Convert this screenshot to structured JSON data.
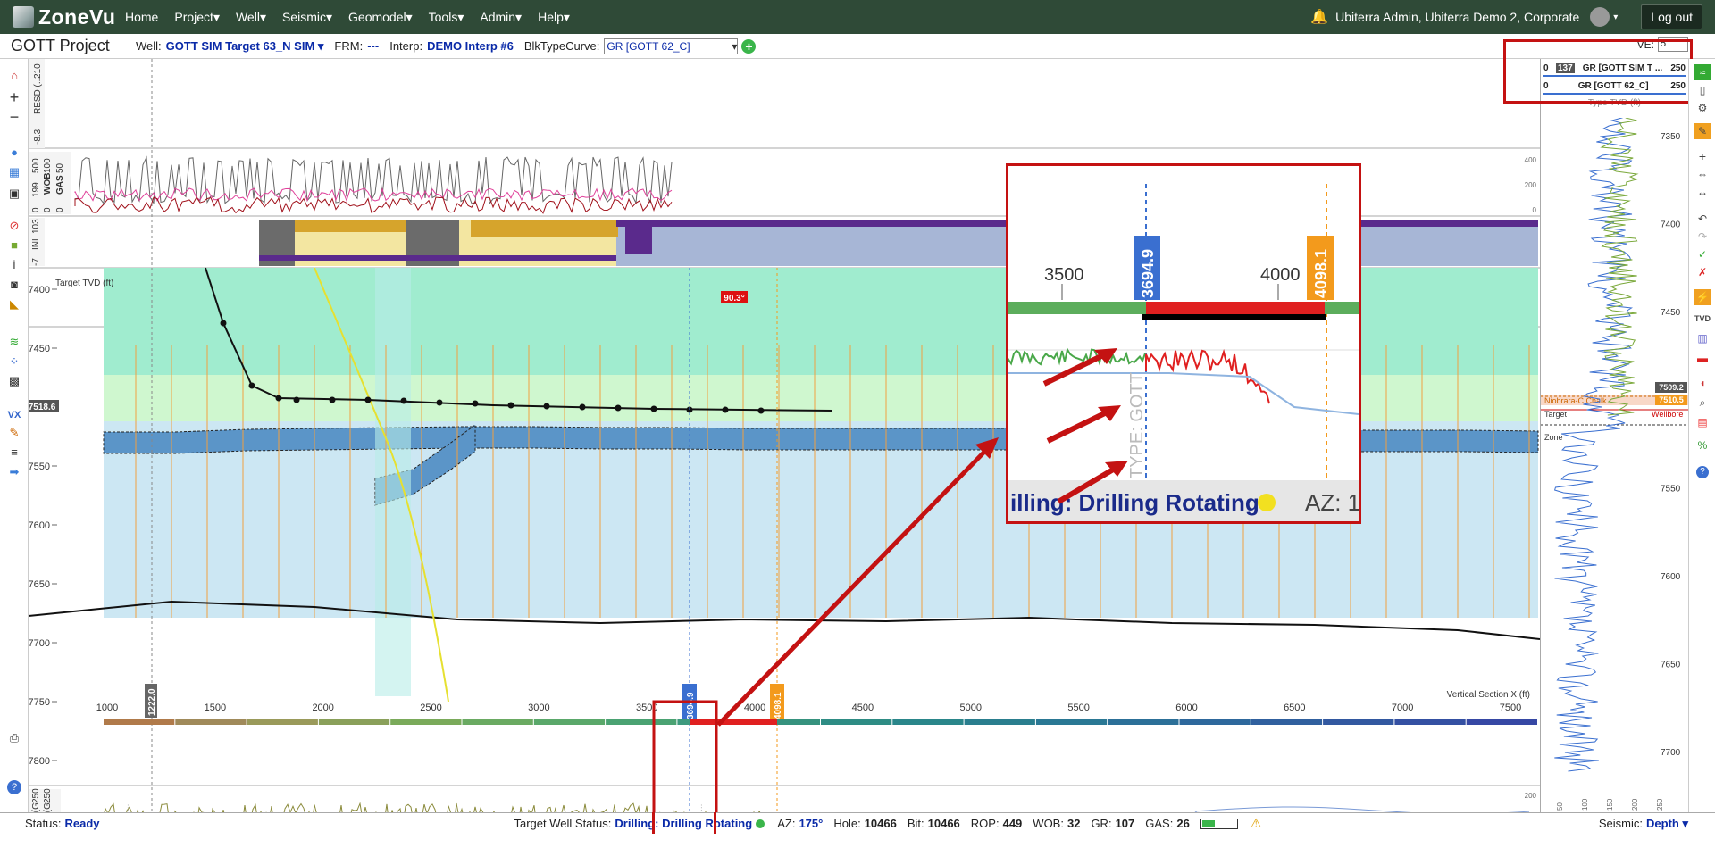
{
  "app": {
    "logo_text": "ZoneVu"
  },
  "nav": [
    "Home",
    "Project",
    "Well",
    "Seismic",
    "Geomodel",
    "Tools",
    "Admin",
    "Help"
  ],
  "user": {
    "name": "Ubiterra Admin, Ubiterra Demo 2, Corporate",
    "logout": "Log out"
  },
  "toolbar": {
    "project": "GOTT Project",
    "well_label": "Well:",
    "well_value": "GOTT SIM Target 63_N SIM",
    "frm_label": "FRM:",
    "frm_value": "---",
    "interp_label": "Interp:",
    "interp_value": "DEMO Interp #6",
    "curve_label": "BlkTypeCurve:",
    "curve_value": "GR [GOTT 62_C]",
    "ve_label": "VE:",
    "ve_value": "5"
  },
  "tracks": {
    "resd_label": "RESD (...",
    "resd_min": "-8.3",
    "resd_max": "210",
    "wob_label": "WOB",
    "wob_min": "0",
    "wob_max": "100",
    "gas_label": "GAS",
    "gas_min": "0",
    "gas_max": "50",
    "rop_min": "0",
    "rop_max": "199",
    "rop2_max": "500",
    "inc_label": "INL",
    "inc_min": "-7",
    "inc_max": "103",
    "ticks_right": [
      "400",
      "200",
      "0"
    ],
    "gr_labels": [
      "GR (G...",
      "GR (G..."
    ],
    "gr_min": "0",
    "gr_max": "250",
    "gr_val": "137",
    "gr_ticks": [
      "200",
      "100"
    ]
  },
  "xsection": {
    "yaxis_label": "Target TVD (ft)",
    "yticks": [
      "7400",
      "7450",
      "7500",
      "7550",
      "7600",
      "7650",
      "7700",
      "7750",
      "7800"
    ],
    "xlabel": "Vertical Section X (ft)",
    "xticks": [
      "1000",
      "1500",
      "2000",
      "2500",
      "3000",
      "3500",
      "4000",
      "4500",
      "5000",
      "5500",
      "6000",
      "6500",
      "7000",
      "7500"
    ],
    "depth_marker": "7518.6",
    "angle_badge": "90.3°",
    "marker_grey": "1222.0",
    "marker_blue": "3694.9",
    "marker_orange": "4098.1",
    "type_gott": "TYPE: GOTT ..."
  },
  "colors": {
    "accent": "#2f4a37",
    "blue_marker": "#3a6fd0",
    "orange_marker": "#f39a1c",
    "highlight": "#c41212"
  },
  "rightpanel": {
    "tracks": [
      {
        "min": "0",
        "val": "137",
        "name": "GR [GOTT SIM T ...",
        "max": "250"
      },
      {
        "min": "0",
        "val": "",
        "name": "GR [GOTT 62_C]",
        "max": "250"
      }
    ],
    "type_label": "Type TVD (ft)",
    "yticks": [
      "7350",
      "7400",
      "7450",
      "7500",
      "7550",
      "7600",
      "7650",
      "7700"
    ],
    "markers": [
      "7509.2",
      "7510.5"
    ],
    "labels": [
      "Niobrara-C Chalk",
      "Target",
      "Wellbore",
      "Zone"
    ],
    "xticks": [
      "50",
      "100",
      "150",
      "200",
      "250"
    ]
  },
  "zoom": {
    "x1": "3500",
    "x2": "4000",
    "blue": "3694.9",
    "orange": "4098.1",
    "status_text": "illing: Drilling Rotating",
    "az_text": "AZ: 1",
    "type_text": "TYPE: GOTT"
  },
  "status": {
    "label": "Status:",
    "value": "Ready",
    "well_status_label": "Target Well Status:",
    "well_status_value": "Drilling: Drilling Rotating",
    "az_label": "AZ:",
    "az_value": "175°",
    "hole_label": "Hole:",
    "hole_value": "10466",
    "bit_label": "Bit:",
    "bit_value": "10466",
    "rop_label": "ROP:",
    "rop_value": "449",
    "wob_label": "WOB:",
    "wob_value": "32",
    "gr_label": "GR:",
    "gr_value": "107",
    "gas_label": "GAS:",
    "gas_value": "26",
    "seismic_label": "Seismic:",
    "seismic_value": "Depth"
  }
}
